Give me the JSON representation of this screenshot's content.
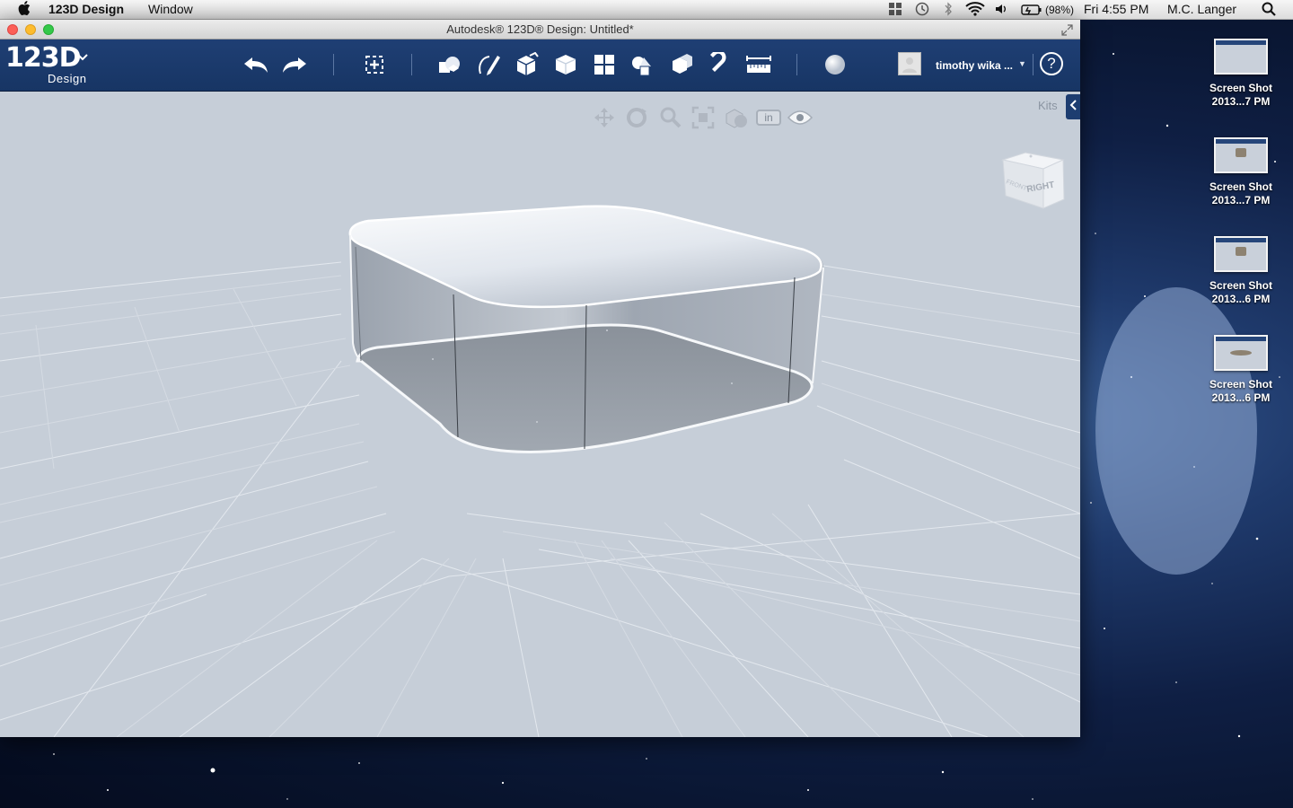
{
  "menubar": {
    "app_name": "123D Design",
    "menu_window": "Window",
    "battery": "(98%)",
    "clock": "Fri 4:55 PM",
    "user": "M.C. Langer"
  },
  "window": {
    "title": "Autodesk® 123D® Design: Untitled*"
  },
  "toolbar": {
    "logo_text": "123D",
    "logo_sub": "Design",
    "buttons": [
      "undo-icon",
      "redo-icon",
      "transform-icon",
      "primitives-icon",
      "sketch-icon",
      "construct-icon",
      "modify-icon",
      "pattern-icon",
      "grouping-icon",
      "combine-icon",
      "snap-icon",
      "measure-icon",
      "material-icon"
    ],
    "username": "timothy wika ...",
    "help_label": "?"
  },
  "viewport": {
    "kits_label": "Kits",
    "units_label": "in",
    "viewcube_label": "RIGHT",
    "viewcube_side_label": "FRONT",
    "nav_buttons": [
      "pan-icon",
      "orbit-icon",
      "zoom-icon",
      "fit-icon",
      "view-mode-icon",
      "units-button",
      "visibility-eye-icon"
    ],
    "background_color": "#c6ced8",
    "accent_color": "#1d3d70"
  },
  "desktop": {
    "files": [
      {
        "line1": "Screen Shot",
        "line2": "2013...7 PM",
        "thumb": "blank"
      },
      {
        "line1": "Screen Shot",
        "line2": "2013...7 PM",
        "thumb": "block"
      },
      {
        "line1": "Screen Shot",
        "line2": "2013...6 PM",
        "thumb": "block"
      },
      {
        "line1": "Screen Shot",
        "line2": "2013...6 PM",
        "thumb": "flat"
      }
    ]
  }
}
